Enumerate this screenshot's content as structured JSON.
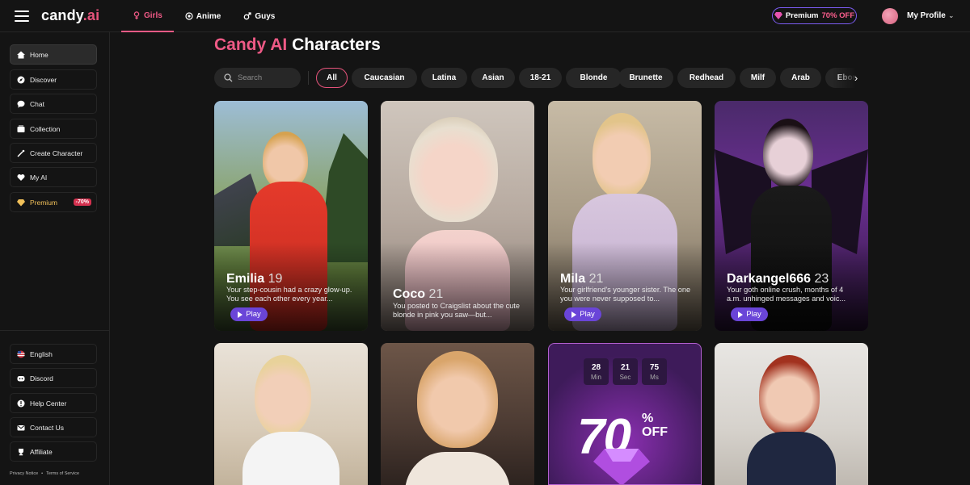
{
  "header": {
    "logo_main": "candy",
    "logo_dot": ".ai",
    "tabs": [
      {
        "label": "Girls",
        "icon": "female-icon",
        "active": true
      },
      {
        "label": "Anime",
        "icon": "anime-icon",
        "active": false
      },
      {
        "label": "Guys",
        "icon": "male-icon",
        "active": false
      }
    ],
    "premium_label": "Premium",
    "premium_off": "70% OFF",
    "profile_label": "My Profile"
  },
  "sidebar": {
    "items": [
      {
        "label": "Home",
        "icon": "home-icon"
      },
      {
        "label": "Discover",
        "icon": "compass-icon"
      },
      {
        "label": "Chat",
        "icon": "chat-icon"
      },
      {
        "label": "Collection",
        "icon": "collection-icon"
      },
      {
        "label": "Create Character",
        "icon": "magic-wand-icon"
      },
      {
        "label": "My AI",
        "icon": "my-ai-icon"
      },
      {
        "label": "Premium",
        "icon": "diamond-icon",
        "badge": "-70%"
      }
    ],
    "bottom": [
      {
        "label": "English",
        "icon": "flag-icon"
      },
      {
        "label": "Discord",
        "icon": "discord-icon"
      },
      {
        "label": "Help Center",
        "icon": "help-icon"
      },
      {
        "label": "Contact Us",
        "icon": "mail-icon"
      },
      {
        "label": "Affiliate",
        "icon": "trophy-icon"
      }
    ],
    "privacy": "Privacy Notice",
    "sep": "•",
    "terms": "Terms of Service"
  },
  "main": {
    "title_pink": "Candy AI",
    "title_white": "Characters",
    "search_placeholder": "Search",
    "filters": [
      "All",
      "Caucasian",
      "Latina",
      "Asian",
      "18-21",
      "Blonde",
      "Brunette",
      "Redhead",
      "Milf",
      "Arab",
      "Ebony"
    ],
    "active_filter": "All"
  },
  "cards": [
    {
      "name": "Emilia",
      "age": "19",
      "desc": "Your step-cousin had a crazy glow-up. You see each other every year...",
      "play": "Play"
    },
    {
      "name": "Coco",
      "age": "21",
      "desc": "You posted to Craigslist about the cute blonde in pink you saw—but...",
      "play": ""
    },
    {
      "name": "Mila",
      "age": "21",
      "desc": "Your girlfriend's younger sister. The one you were never supposed to...",
      "play": "Play"
    },
    {
      "name": "Darkangel666",
      "age": "23",
      "desc": "Your goth online crush, months of 4 a.m. unhinged messages and voic...",
      "play": "Play"
    }
  ],
  "promo": {
    "timer": [
      {
        "value": "28",
        "unit": "Min"
      },
      {
        "value": "21",
        "unit": "Sec"
      },
      {
        "value": "75",
        "unit": "Ms"
      }
    ],
    "big": "70",
    "percent": "%",
    "off": "OFF"
  },
  "colors": {
    "accent": "#ef5a86",
    "play": "#6a45d8",
    "premium_border": "#7c5cf2",
    "bg": "#141414"
  }
}
